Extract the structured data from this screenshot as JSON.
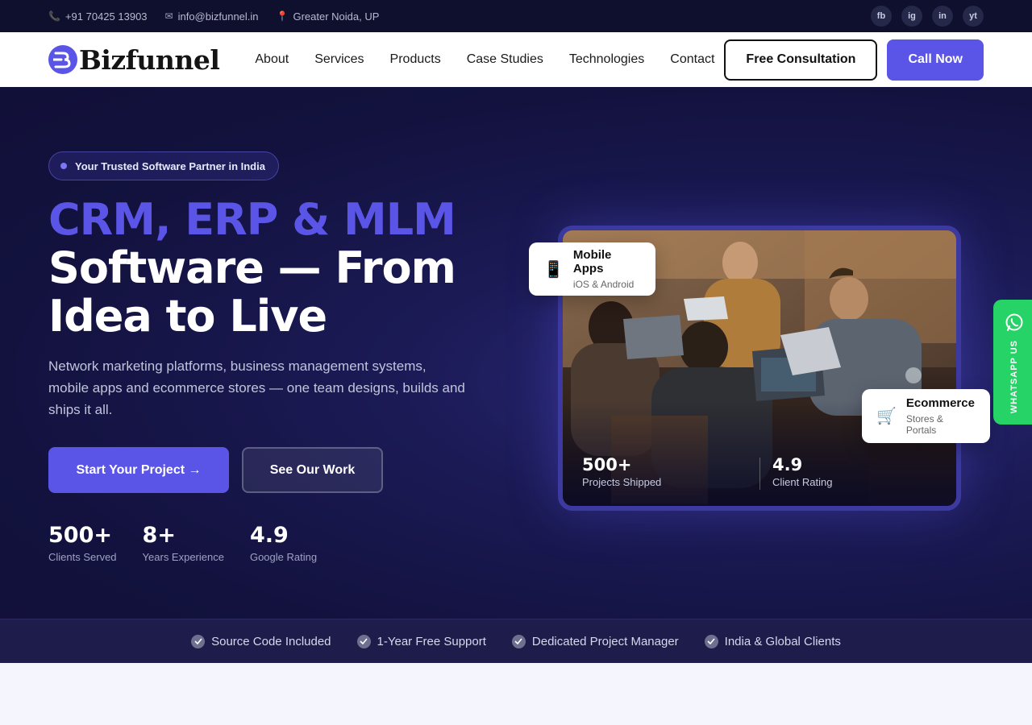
{
  "topbar": {
    "phone": "+91 70425 13903",
    "email": "info@bizfunnel.in",
    "location": "Greater Noida, UP",
    "social": [
      "fb",
      "ig",
      "in",
      "yt"
    ]
  },
  "nav": {
    "logo_text": "Bizfunnel",
    "menu": [
      "About",
      "Services",
      "Products",
      "Case Studies",
      "Technologies",
      "Contact"
    ],
    "consult_label": "Free Consultation",
    "call_label": "Call Now"
  },
  "hero": {
    "badge": "Your Trusted Software Partner in India",
    "title_accent": "CRM, ERP & MLM",
    "title_line2": "Software — From",
    "title_line3": "Idea to Live",
    "lead": "Network marketing platforms, business management systems, mobile apps and ecommerce stores — one team designs, builds and ships it all.",
    "cta_primary": "Start Your Project →",
    "cta_secondary": "See Our Work",
    "stats": [
      {
        "num": "500+",
        "label": "Clients Served"
      },
      {
        "num": "8+",
        "label": "Years Experience"
      },
      {
        "num": "4.9",
        "label": "Google Rating"
      }
    ]
  },
  "image_card": {
    "stats": [
      {
        "num": "500+",
        "label": "Projects Shipped"
      },
      {
        "num": "4.9",
        "label": "Client Rating"
      }
    ]
  },
  "float_cards": {
    "mobile": {
      "title": "Mobile Apps",
      "sub": "iOS & Android",
      "icon": "phone-icon"
    },
    "ecom": {
      "title": "Ecommerce",
      "sub": "Stores & Portals",
      "icon": "cart-icon"
    }
  },
  "whatsapp": {
    "label": "WHATSAPP US"
  },
  "features": [
    "Source Code Included",
    "1-Year Free Support",
    "Dedicated Project Manager",
    "India & Global Clients"
  ],
  "colors": {
    "accent": "#5a55e6",
    "hero_bg": "#13123f",
    "whatsapp": "#25d366"
  }
}
